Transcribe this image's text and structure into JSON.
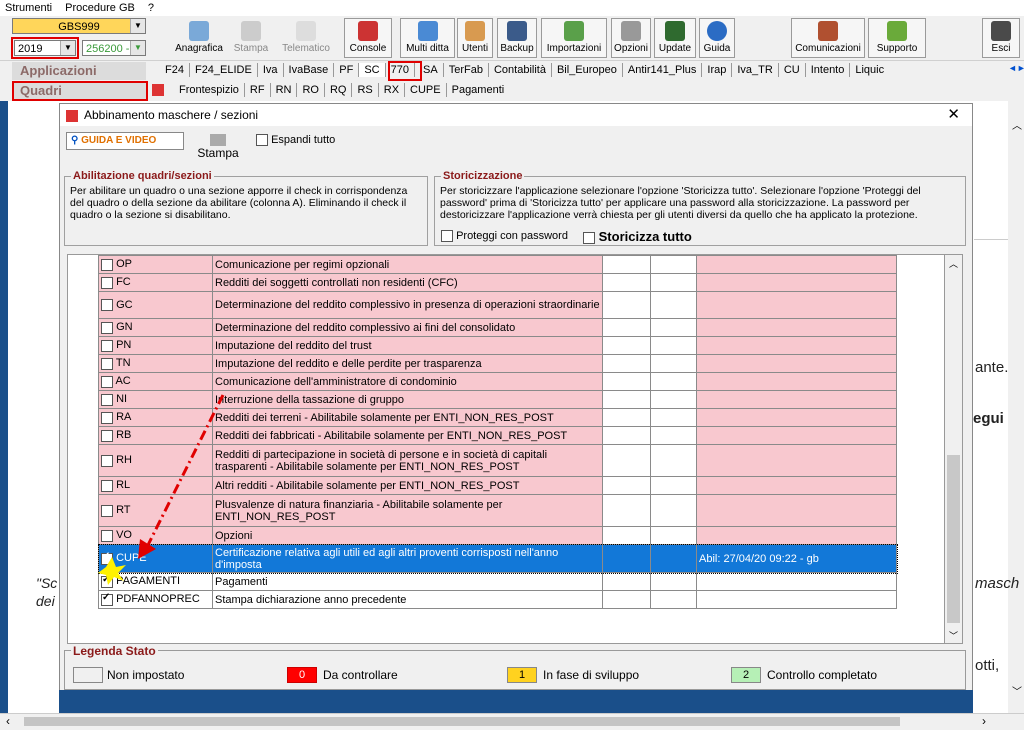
{
  "menu": [
    "Strumenti",
    "Procedure GB",
    "?"
  ],
  "top": {
    "product": "GBS999",
    "year": "2019",
    "user": "256200 -"
  },
  "toolbar": [
    {
      "label": "Anagrafica",
      "icon": "address-book-icon"
    },
    {
      "label": "Stampa",
      "icon": "printer-icon"
    },
    {
      "label": "Telematico",
      "icon": "telematic-icon"
    },
    {
      "label": "Console",
      "icon": "console-icon"
    },
    {
      "label": "Multi ditta",
      "icon": "multi-company-icon"
    },
    {
      "label": "Utenti",
      "icon": "users-icon"
    },
    {
      "label": "Backup",
      "icon": "backup-icon"
    },
    {
      "label": "Importazioni",
      "icon": "import-icon"
    },
    {
      "label": "Opzioni",
      "icon": "options-icon"
    },
    {
      "label": "Update",
      "icon": "update-icon"
    },
    {
      "label": "Guida",
      "icon": "help-icon"
    },
    {
      "label": "Comunicazioni",
      "icon": "communications-icon"
    },
    {
      "label": "Supporto",
      "icon": "support-icon"
    },
    {
      "label": "Esci",
      "icon": "exit-icon"
    }
  ],
  "applicazioni_label": "Applicazioni",
  "quadri_label": "Quadri",
  "app_tabs": [
    "F24",
    "F24_ELIDE",
    "Iva",
    "IvaBase",
    "PF",
    "SC",
    "770",
    "ISA",
    "TerFab",
    "Contabilità",
    "Bil_Europeo",
    "Antir141_Plus",
    "Irap",
    "Iva_TR",
    "CU",
    "Intento",
    "Liquic"
  ],
  "quadri_tabs": [
    "Frontespizio",
    "RF",
    "RN",
    "RO",
    "RQ",
    "RS",
    "RX",
    "CUPE",
    "Pagamenti"
  ],
  "dialog": {
    "title": "Abbinamento maschere / sezioni",
    "guide_button": "GUIDA E VIDEO",
    "print_button": "Stampa",
    "expand_all": "Espandi tutto",
    "abil_title": "Abilitazione quadri/sezioni",
    "abil_text": "Per abilitare un quadro o una sezione apporre il check in corrispondenza del quadro o della sezione da abilitare (colonna A). Eliminando il check il quadro o la sezione si disabilitano.",
    "stor_title": "Storicizzazione",
    "stor_text": "Per storicizzare l'applicazione selezionare l'opzione 'Storicizza tutto'. Selezionare l'opzione 'Proteggi del password' prima di 'Storicizza tutto' per applicare una password alla storicizzazione. La password per destoricizzare l'applicazione verrà chiesta per gli utenti diversi da quello che ha applicato la protezione.",
    "protect_label": "Proteggi con password",
    "stor_all_label": "Storicizza tutto",
    "legend_title": "Legenda Stato",
    "legend": [
      {
        "num": "",
        "label": "Non impostato",
        "color": "#ffffff"
      },
      {
        "num": "0",
        "label": "Da controllare",
        "color": "#ff0000"
      },
      {
        "num": "1",
        "label": "In fase di sviluppo",
        "color": "#ffd21f"
      },
      {
        "num": "2",
        "label": "Controllo completato",
        "color": "#b6f0b6"
      }
    ]
  },
  "rows": [
    {
      "code": "OP",
      "desc": "Comunicazione per regimi opzionali",
      "checked": false,
      "status": "pink",
      "h": 18
    },
    {
      "code": "FC",
      "desc": "Redditi dei soggetti controllati non residenti (CFC)",
      "checked": false,
      "status": "pink",
      "h": 18
    },
    {
      "code": "GC",
      "desc": "Determinazione del reddito complessivo in presenza di operazioni straordinarie",
      "checked": false,
      "status": "pink",
      "h": 27
    },
    {
      "code": "GN",
      "desc": "Determinazione del reddito complessivo ai fini del consolidato",
      "checked": false,
      "status": "pink",
      "h": 18
    },
    {
      "code": "PN",
      "desc": "Imputazione del reddito del trust",
      "checked": false,
      "status": "pink",
      "h": 18
    },
    {
      "code": "TN",
      "desc": "Imputazione del reddito e delle perdite per trasparenza",
      "checked": false,
      "status": "pink",
      "h": 18
    },
    {
      "code": "AC",
      "desc": "Comunicazione dell'amministratore di condominio",
      "checked": false,
      "status": "pink",
      "h": 18
    },
    {
      "code": "NI",
      "desc": "Interruzione della tassazione di gruppo",
      "checked": false,
      "status": "pink",
      "h": 18
    },
    {
      "code": "RA",
      "desc": "Redditi dei terreni - Abilitabile solamente per ENTI_NON_RES_POST",
      "checked": false,
      "status": "pink",
      "h": 18
    },
    {
      "code": "RB",
      "desc": "Redditi dei fabbricati - Abilitabile solamente per ENTI_NON_RES_POST",
      "checked": false,
      "status": "pink",
      "h": 18
    },
    {
      "code": "RH",
      "desc": "Redditi di partecipazione in società di persone e in società di capitali trasparenti - Abilitabile solamente per ENTI_NON_RES_POST",
      "checked": false,
      "status": "pink",
      "h": 32
    },
    {
      "code": "RL",
      "desc": "Altri redditi - Abilitabile solamente per ENTI_NON_RES_POST",
      "checked": false,
      "status": "pink",
      "h": 18
    },
    {
      "code": "RT",
      "desc": "Plusvalenze di natura finanziaria - Abilitabile solamente per ENTI_NON_RES_POST",
      "checked": false,
      "status": "pink",
      "h": 32
    },
    {
      "code": "VO",
      "desc": "Opzioni",
      "checked": false,
      "status": "pink",
      "h": 18
    },
    {
      "code": "CUPE",
      "desc": "Certificazione relativa agli utili ed agli altri proventi corrisposti nell'anno d'imposta",
      "checked": true,
      "status": "sel",
      "note": "Abil: 27/04/20 09:22 - gb",
      "h": 28
    },
    {
      "code": "PAGAMENTI",
      "desc": "Pagamenti",
      "checked": true,
      "status": "white",
      "h": 18
    },
    {
      "code": "PDFANNOPREC",
      "desc": "Stampa dichiarazione anno precedente",
      "checked": true,
      "status": "white",
      "h": 18
    }
  ],
  "bg_text": {
    "r1": "ante.",
    "r2": "egui",
    "r3": "masch",
    "r4": "otti,",
    "l1": "\"Sc",
    "l2": "dei"
  }
}
